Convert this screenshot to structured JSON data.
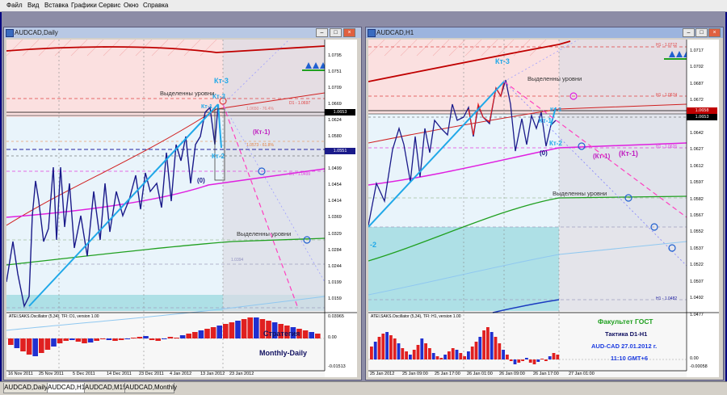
{
  "menu": [
    "Файл",
    "Вид",
    "Вставка",
    "Графики",
    "Сервис",
    "Окно",
    "Справка"
  ],
  "tabs": [
    "AUDCAD,Daily",
    "AUDCAD,H1",
    "AUDCAD,M15",
    "AUDCAD,Monthly"
  ],
  "active_tab": 1,
  "left": {
    "title": "AUDCAD,Daily",
    "buttons": {
      "min": "–",
      "max": "□",
      "close": "×"
    },
    "prices": [
      "1.0795",
      "1.0751",
      "1.0709",
      "1.0669",
      "1.0624",
      "1.0580",
      "1.0540",
      "1.0499",
      "1.0454",
      "1.0414",
      "1.0369",
      "1.0329",
      "1.0284",
      "1.0244",
      "1.0199",
      "1.0159",
      "1.0114",
      "1.0074"
    ],
    "price_current": "1.0653",
    "price_marker2": "1.0551",
    "dates": [
      "16 Nov 2011",
      "25 Nov 2011",
      "5 Dec 2011",
      "14 Dec 2011",
      "23 Dec 2011",
      "4 Jan 2012",
      "13 Jan 2012",
      "23 Jan 2012"
    ],
    "osc_label": "ATEI.SAKS.Oscillator (5,34), TFI: D1, version 1.00",
    "osc_scale": [
      "0.03965",
      "0.00",
      "-0.01513"
    ],
    "labels": {
      "kt3": "Кт-3",
      "kt1": "Кт-1",
      "kt2": "Кт-2",
      "kt1p": "(Кт-1)",
      "zero": "(0)",
      "levels_a": "Выделенны уровни",
      "levels_b": "Выделенны уровни",
      "d1": "D1 - 1.0697",
      "d1b": "D1 - 1.0499",
      "f1": "1.0650 - 76.4%",
      "f2": "1.0573 - 61.8%",
      "f3": "1.0394",
      "strategy": "Стратегия",
      "monthly": "Monthly-Daily"
    }
  },
  "right": {
    "title": "AUDCAD,H1",
    "buttons": {
      "min": "–",
      "max": "□",
      "close": "×"
    },
    "prices": [
      "1.0717",
      "1.0702",
      "1.0687",
      "1.0672",
      "1.0657",
      "1.0642",
      "1.0627",
      "1.0612",
      "1.0597",
      "1.0582",
      "1.0567",
      "1.0552",
      "1.0537",
      "1.0522",
      "1.0507",
      "1.0492",
      "1.0477"
    ],
    "price_current": "1.0658",
    "price_marker2": "1.0653",
    "dates": [
      "25 Jan 2012",
      "25 Jan 09:00",
      "25 Jan 17:00",
      "26 Jan 01:00",
      "26 Jan 09:00",
      "26 Jan 17:00",
      "27 Jan 01:00"
    ],
    "osc_label": "ATEI.SAKS.Oscillator (5,34), TFI: H1, version 1.00",
    "osc_scale": [
      "0.00",
      "-0.00058"
    ],
    "labels": {
      "kt3": "Кт-3",
      "kt1": "Кт-1",
      "kt2": "Кт-2",
      "kt1a": "(Кт-1)",
      "kt1b": "(Кт-1)",
      "zero": "(0)",
      "levels_a": "Выделенны уровни",
      "levels_b": "Выделенны уровни",
      "h1a": "H1 - 1.0712",
      "h1b": "H1 - 1.0674",
      "h1c": "H1 - 1.0626",
      "h1d": "H1 - 1.0482",
      "m2": "-2",
      "faculty": "Факультет ГОСТ",
      "tactic": "Тактика  D1-H1",
      "date": "AUD-CAD 27.01.2012 г.",
      "time": "11:10   GMT+6"
    }
  },
  "colors": {
    "bull": "#e02020",
    "bear": "#2030d0",
    "line": "#1a1a8a",
    "ema_red": "#cc0000",
    "ema_green": "#20a020",
    "ema_magenta": "#e020e0",
    "cyan": "#20a8e8"
  }
}
